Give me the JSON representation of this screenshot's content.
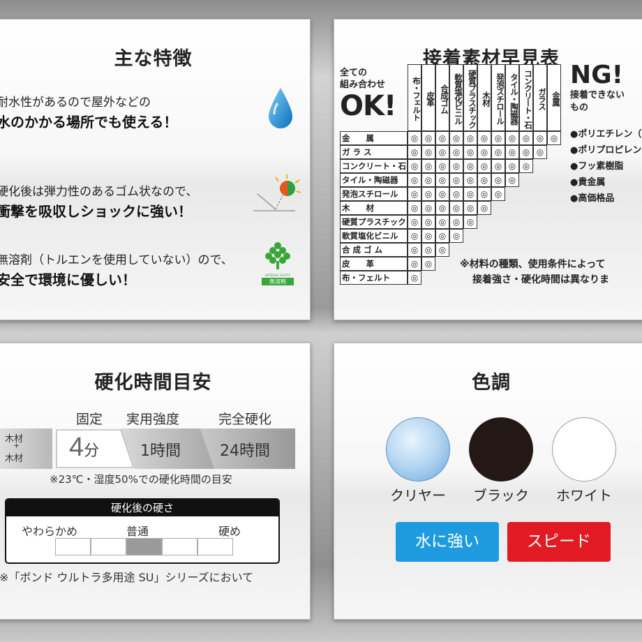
{
  "features": {
    "title": "主な特徴",
    "items": [
      {
        "line1": "耐水性があるので屋外などの",
        "line2": "水のかかる場所でも使える！",
        "icon": "water-drop-icon"
      },
      {
        "line1": "硬化後は弾力性のあるゴム状なので、",
        "line2": "衝撃を吸収しショックに強い！",
        "icon": "impact-ball-icon"
      },
      {
        "line1": "無溶剤（トルエンを使用していない）ので、",
        "line2": "安全で環境に優しい！",
        "icon": "tree-badge-icon",
        "badge_top": "MATERIAL SAFETY",
        "badge_text": "無溶剤"
      }
    ]
  },
  "table": {
    "title": "接着素材早見表",
    "ok": {
      "line1": "全ての",
      "line2": "組み合わせ",
      "big": "OK!"
    },
    "columns": [
      "布・フェルト",
      "皮革",
      "合成ゴム",
      "軟質塩化ビニル",
      "硬質プラスチック",
      "木材",
      "発泡スチロール",
      "タイル・陶磁器",
      "コンクリート・石",
      "ガラス",
      "金属"
    ],
    "rows": [
      "金　　属",
      "ガ ラ ス",
      "コンクリート・石",
      "タイル・陶磁器",
      "発泡スチロール",
      "木　　材",
      "硬質プラスチック",
      "軟質塩化ビニル",
      "合 成 ゴ ム",
      "皮　　革",
      "布・フェルト"
    ],
    "mark": "◎",
    "ng": {
      "big": "NG!",
      "line1": "接着できない",
      "line2": "もの",
      "items": [
        "●ポリエチレン（",
        "●ポリプロピレン（",
        "●フッ素樹脂",
        "●貴金属",
        "●高価格品"
      ]
    },
    "note": [
      "※材料の種類、使用条件によって",
      "接着強さ・硬化時間は異なりま"
    ]
  },
  "cure": {
    "title": "硬化時間目安",
    "stages": [
      "固定",
      "実用強度",
      "完全硬化"
    ],
    "material_top": "木材",
    "material_plus": "+",
    "material_bottom": "木材",
    "fix_num": "4",
    "fix_unit": "分",
    "strength_time": "1時間",
    "full_time": "24時間",
    "caption": "※23℃・湿度50%での硬化時間の目安",
    "hardness": {
      "header": "硬化後の硬さ",
      "soft": "やわらかめ",
      "normal": "普通",
      "hard": "硬め",
      "level": 3,
      "segments": 5
    },
    "footnote": "※「ボンド ウルトラ多用途 SU」シリーズにおいて"
  },
  "colors": {
    "title": "色調",
    "swatches": [
      {
        "label": "クリヤー",
        "color": "#b9d8f2"
      },
      {
        "label": "ブラック",
        "color": "#231815"
      },
      {
        "label": "ホワイト",
        "color": "#ffffff"
      }
    ],
    "buttons": [
      {
        "label": "水に強い",
        "color": "#1e9be0"
      },
      {
        "label": "スピード",
        "color": "#e11a23"
      }
    ]
  }
}
